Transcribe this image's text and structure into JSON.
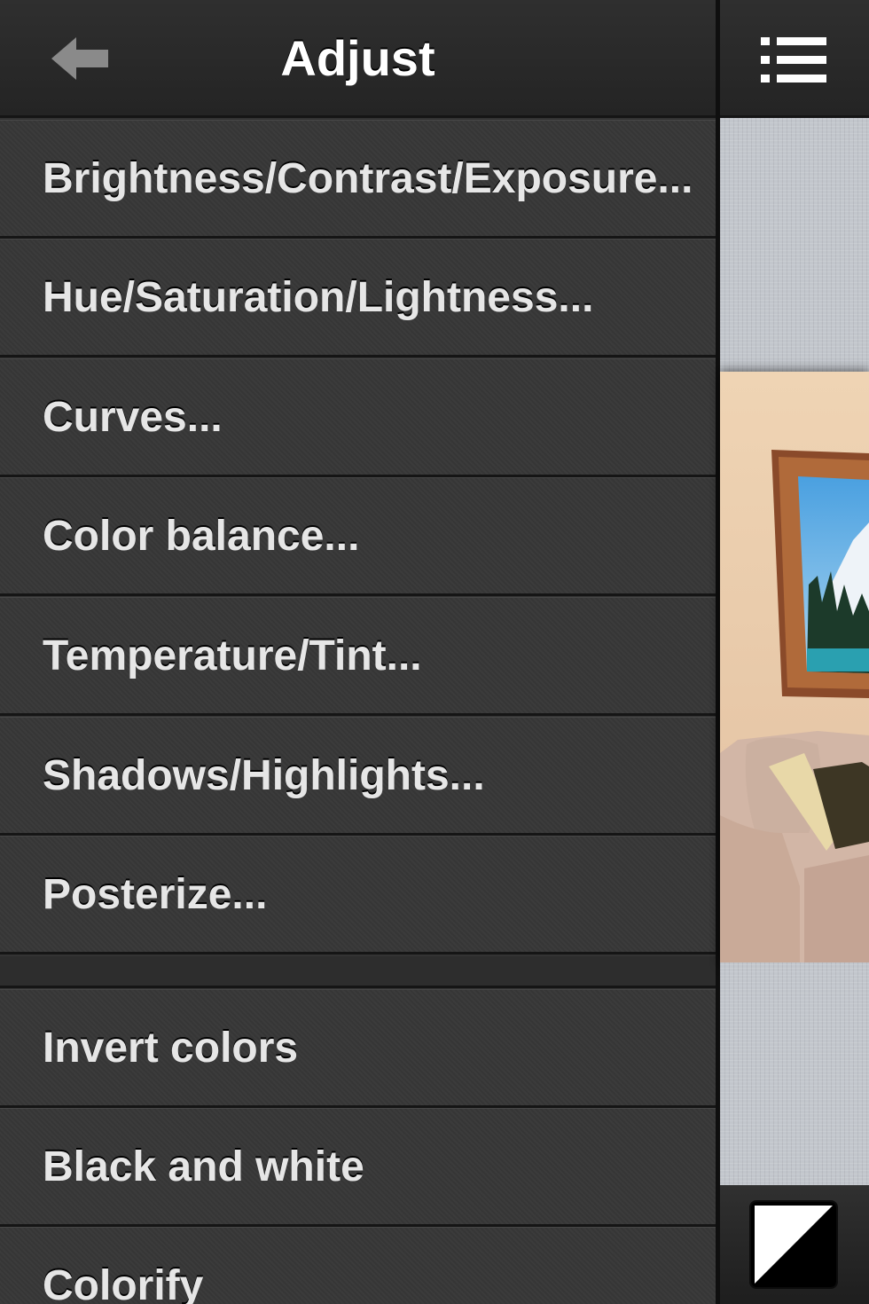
{
  "header": {
    "title": "Adjust",
    "back_icon": "back-arrow-icon",
    "menu_icon": "list-icon"
  },
  "menu": {
    "items": [
      {
        "label": "Brightness/Contrast/Exposure..."
      },
      {
        "label": "Hue/Saturation/Lightness..."
      },
      {
        "label": "Curves..."
      },
      {
        "label": "Color balance..."
      },
      {
        "label": "Temperature/Tint..."
      },
      {
        "label": "Shadows/Highlights..."
      },
      {
        "label": "Posterize..."
      },
      {
        "label": "Invert colors"
      },
      {
        "label": "Black and white"
      },
      {
        "label": "Colorify"
      }
    ]
  },
  "toolbar": {
    "contrast_icon": "contrast-icon"
  },
  "colors": {
    "panel_bg": "#373737",
    "header_bg": "#2a2a2a",
    "text": "#e6e6e6",
    "title": "#ffffff",
    "linen": "#c2c6cc"
  }
}
